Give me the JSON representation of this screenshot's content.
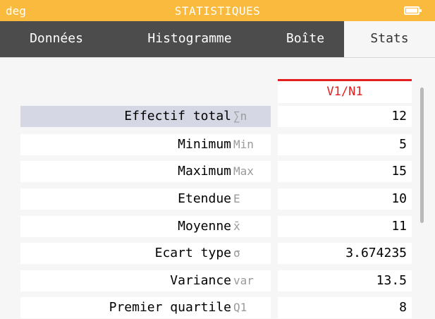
{
  "titlebar": {
    "mode": "deg",
    "title": "STATISTIQUES",
    "battery_icon": "battery-icon"
  },
  "tabs": [
    {
      "label": "Données",
      "active": false
    },
    {
      "label": "Histogramme",
      "active": false
    },
    {
      "label": "Boîte",
      "active": false
    },
    {
      "label": "Stats",
      "active": true
    }
  ],
  "table": {
    "column_header": "V1/N1",
    "rows": [
      {
        "name": "Effectif total",
        "symbol": "∑n",
        "value": "12"
      },
      {
        "name": "Minimum",
        "symbol": "Min",
        "value": "5"
      },
      {
        "name": "Maximum",
        "symbol": "Max",
        "value": "15"
      },
      {
        "name": "Etendue",
        "symbol": "E",
        "value": "10"
      },
      {
        "name": "Moyenne",
        "symbol": "x̄",
        "value": "11"
      },
      {
        "name": "Ecart type",
        "symbol": "σ",
        "value": "3.674235"
      },
      {
        "name": "Variance",
        "symbol": "var",
        "value": "13.5"
      },
      {
        "name": "Premier quartile",
        "symbol": "Q1",
        "value": "8"
      }
    ]
  },
  "colors": {
    "titlebar": "#f9ba3e",
    "tabs": "#4c4c4c",
    "column_header_accent": "#e31f1f",
    "selected_row": "#d5d8e4"
  }
}
